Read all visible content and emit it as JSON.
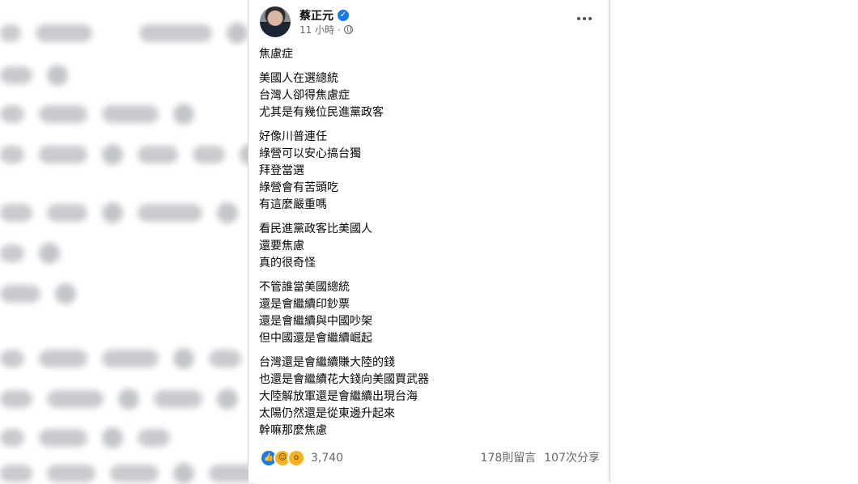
{
  "post": {
    "author": "蔡正元",
    "time": "11 小時",
    "paragraphs": [
      [
        "焦慮症"
      ],
      [
        "美國人在選總統",
        "台灣人卻得焦慮症",
        "尤其是有幾位民進黨政客"
      ],
      [
        "好像川普連任",
        "綠營可以安心搞台獨",
        "拜登當選",
        "綠營會有苦頭吃",
        "有這麼嚴重嗎"
      ],
      [
        "看民進黨政客比美國人",
        "還要焦慮",
        "真的很奇怪"
      ],
      [
        "不管誰當美國總統",
        "還是會繼續印鈔票",
        "還是會繼續與中國吵架",
        "但中國還是會繼續崛起"
      ],
      [
        "台灣還是會繼續賺大陸的錢",
        "也還是會繼續花大錢向美國買武器",
        "大陸解放軍還是會繼續出現台海",
        "太陽仍然還是從東邊升起來",
        "幹嘛那麼焦慮"
      ]
    ],
    "reaction_count": "3,740",
    "comments": "178則留言",
    "shares": "107次分享",
    "icons": [
      "verified-icon",
      "globe-icon",
      "more-icon",
      "like-icon",
      "haha-icon",
      "wow-icon"
    ]
  }
}
